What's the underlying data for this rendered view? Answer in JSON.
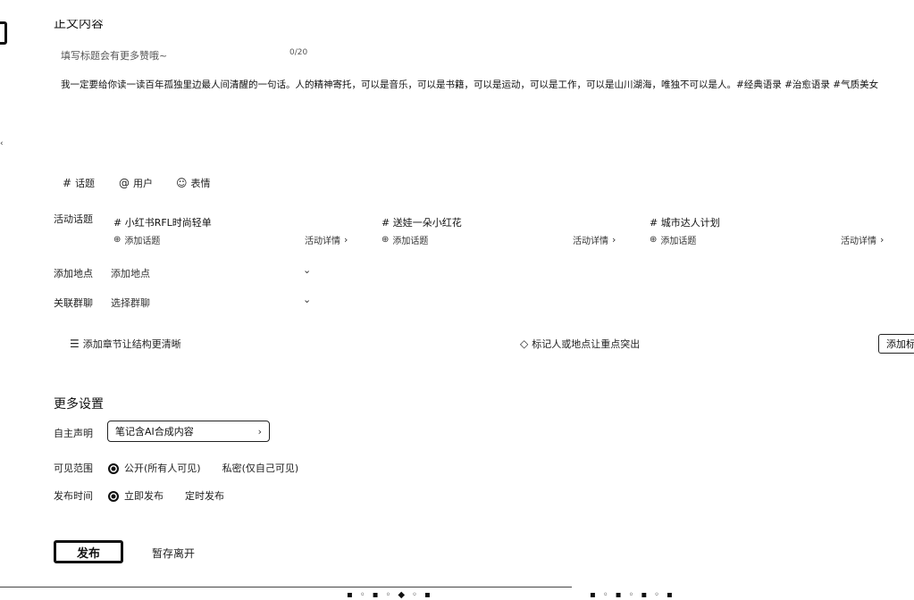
{
  "header": {
    "cut_title": "正文内容"
  },
  "editor": {
    "title_placeholder": "填写标题会有更多赞哦~",
    "title_counter": "0/20",
    "body_text": "我一定要给你读一读百年孤独里边最人间清醒的一句话。人的精神寄托，可以是音乐，可以是书籍，可以是运动，可以是工作，可以是山川湖海，唯独不可以是人。#经典语录 #治愈语录 #气质美女"
  },
  "toolbar": {
    "topic": {
      "icon": "hash-icon",
      "label": "话题"
    },
    "user": {
      "icon": "at-icon",
      "label": "用户"
    },
    "emoji": {
      "icon": "smile-icon",
      "label": "表情"
    }
  },
  "activity": {
    "label": "活动话题",
    "topics": [
      {
        "name": "# 小红书RFL时尚轻单",
        "add": "添加话题",
        "detail": "活动详情"
      },
      {
        "name": "# 送娃一朵小红花",
        "add": "添加话题",
        "detail": "活动详情"
      },
      {
        "name": "# 城市达人计划",
        "add": "添加话题",
        "detail": "活动详情"
      }
    ]
  },
  "location": {
    "label": "添加地点",
    "placeholder": "添加地点"
  },
  "group": {
    "label": "关联群聊",
    "placeholder": "选择群聊"
  },
  "features": {
    "chapter": {
      "icon": "chapter-icon",
      "label": "添加章节让结构更清晰"
    },
    "mark": {
      "icon": "tag-icon",
      "label": "标记人或地点让重点突出"
    },
    "add_button": "添加标"
  },
  "more_settings": {
    "title": "更多设置",
    "declaration": {
      "label": "自主声明",
      "value": "笔记含AI合成内容"
    },
    "visibility": {
      "label": "可见范围",
      "options": [
        "公开(所有人可见)",
        "私密(仅自己可见)"
      ],
      "selected": "公开(所有人可见)"
    },
    "publish_time": {
      "label": "发布时间",
      "options": [
        "立即发布",
        "定时发布"
      ],
      "selected": "立即发布"
    }
  },
  "actions": {
    "publish": "发布",
    "save_draft": "暂存离开"
  }
}
